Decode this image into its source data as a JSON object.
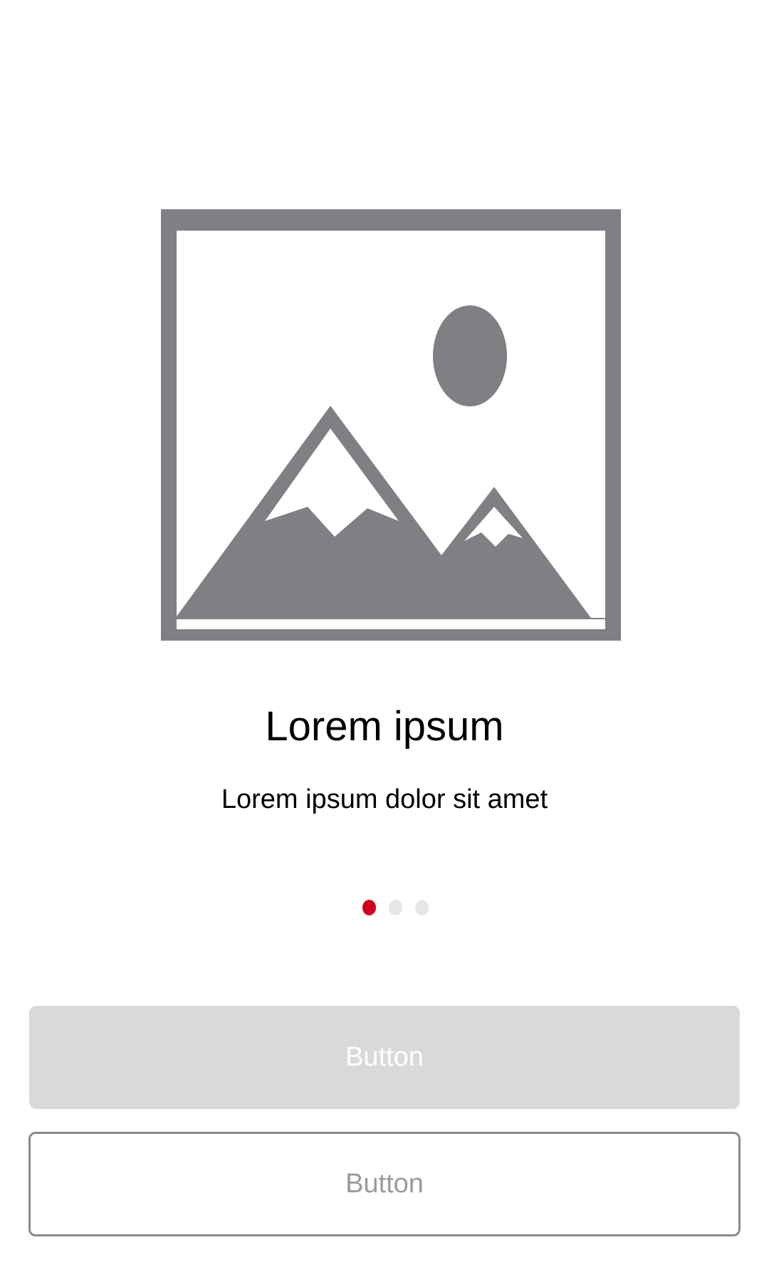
{
  "hero": {
    "icon": "image-placeholder-icon",
    "color": "#7f8083"
  },
  "title": "Lorem ipsum",
  "subtitle": "Lorem ipsum dolor sit amet",
  "pager": {
    "total": 3,
    "active_index": 0,
    "active_color": "#d0021b",
    "inactive_color": "#e6e6e6"
  },
  "buttons": {
    "primary_label": "Button",
    "secondary_label": "Button"
  }
}
